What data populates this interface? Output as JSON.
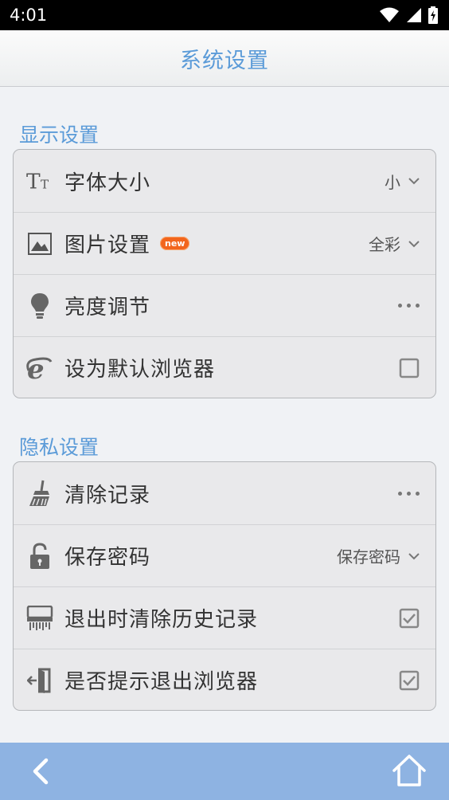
{
  "status_bar": {
    "time": "4:01"
  },
  "header": {
    "title": "系统设置"
  },
  "display_section": {
    "title": "显示设置",
    "items": [
      {
        "label": "字体大小",
        "value": "小",
        "control": "dropdown",
        "icon": "font-size-icon"
      },
      {
        "label": "图片设置",
        "badge": "new",
        "value": "全彩",
        "control": "dropdown",
        "icon": "image-icon"
      },
      {
        "label": "亮度调节",
        "control": "more",
        "icon": "lightbulb-icon"
      },
      {
        "label": "设为默认浏览器",
        "control": "checkbox",
        "checked": false,
        "icon": "browser-icon"
      }
    ]
  },
  "privacy_section": {
    "title": "隐私设置",
    "items": [
      {
        "label": "清除记录",
        "control": "more",
        "icon": "broom-icon"
      },
      {
        "label": "保存密码",
        "value": "保存密码",
        "control": "dropdown",
        "icon": "lock-icon"
      },
      {
        "label": "退出时清除历史记录",
        "control": "checkbox",
        "checked": true,
        "icon": "shredder-icon"
      },
      {
        "label": "是否提示退出浏览器",
        "control": "checkbox",
        "checked": true,
        "icon": "exit-icon"
      }
    ]
  },
  "bottom_bar": {
    "back_icon": "back-icon",
    "home_icon": "home-icon"
  },
  "colors": {
    "accent": "#5b9bd8",
    "bottom_bar": "#8eb3e2",
    "badge": "#f2651d"
  }
}
